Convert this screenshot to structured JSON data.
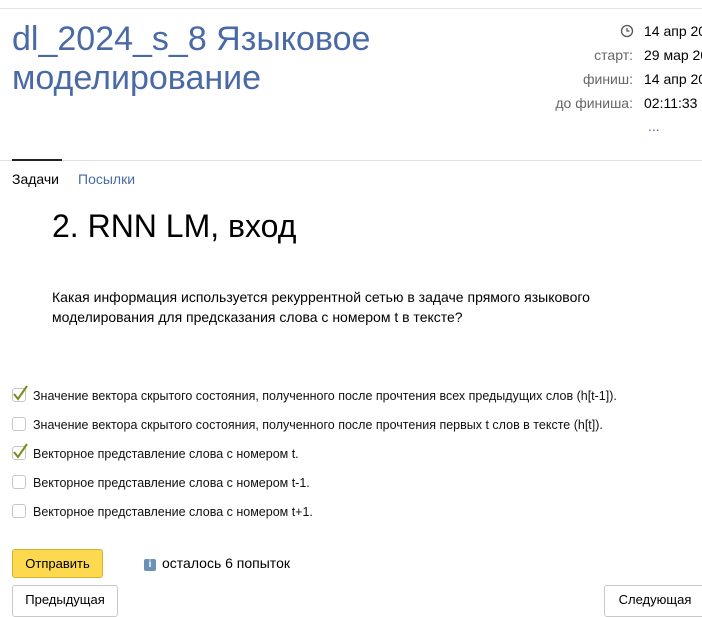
{
  "contest": {
    "title": "dl_2024_s_8 Языковое моделирование"
  },
  "info": {
    "current_date": "14 апр 20",
    "start_label": "старт:",
    "start_value": "29 мар 20",
    "finish_label": "финиш:",
    "finish_value": "14 апр 20",
    "remaining_label": "до финиша:",
    "remaining_value": "02:11:33",
    "more": "..."
  },
  "tabs": {
    "tasks": "Задачи",
    "submissions": "Посылки"
  },
  "problem": {
    "title": "2. RNN LM, вход",
    "question": "Какая информация используется рекуррентной сетью в задаче прямого языкового моделирования для предсказания слова с номером t в тексте?",
    "options": [
      {
        "label": "Значение вектора скрытого состояния, полученного после прочтения всех предыдущих слов (h[t-1]).",
        "checked": true
      },
      {
        "label": "Значение вектора скрытого состояния, полученного после прочтения первых t слов в тексте (h[t]).",
        "checked": false
      },
      {
        "label": "Векторное представление слова с номером t.",
        "checked": true
      },
      {
        "label": "Векторное представление слова с номером t-1.",
        "checked": false
      },
      {
        "label": "Векторное представление слова с номером t+1.",
        "checked": false
      }
    ]
  },
  "actions": {
    "submit": "Отправить",
    "attempts": "осталось 6 попыток",
    "prev": "Предыдущая",
    "next": "Следующая"
  },
  "colors": {
    "accent": "#4a6aa5",
    "submit_bg": "#fcd94f",
    "check": "#7a8a1a"
  }
}
